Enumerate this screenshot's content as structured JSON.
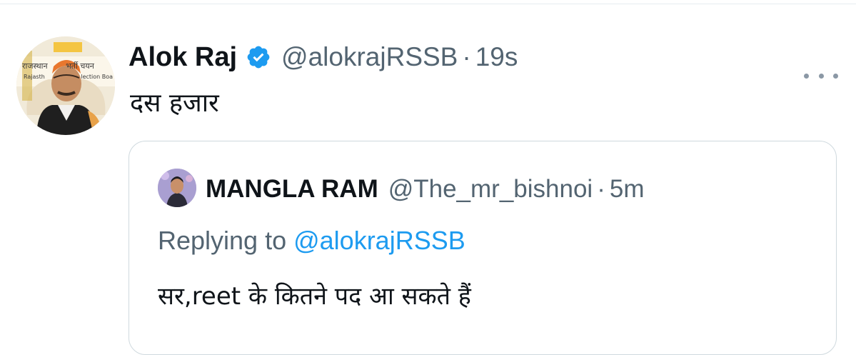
{
  "tweet": {
    "author_name": "Alok Raj",
    "handle": "@alokrajRSSB",
    "separator": "·",
    "time": "19s",
    "text": "दस हजार",
    "verified": true,
    "icons": {
      "verified": "verified-badge-icon",
      "more": "more-horizontal-icon"
    },
    "avatar_banner_text": [
      "राजस्थान",
      "भर्ती चयन",
      "Rajasth",
      "lection Boa"
    ]
  },
  "quoted_tweet": {
    "author_name": "MANGLA RAM",
    "handle": "@The_mr_bishnoi",
    "separator": "·",
    "time": "5m",
    "replying_prefix": "Replying to ",
    "replying_handle": "@alokrajRSSB",
    "text": "सर,reet के कितने पद आ सकते हैं"
  },
  "colors": {
    "text_primary": "#0f1419",
    "text_secondary": "#536471",
    "link": "#1d9bf0",
    "verified": "#1d9bf0",
    "border": "#cfd9de"
  }
}
